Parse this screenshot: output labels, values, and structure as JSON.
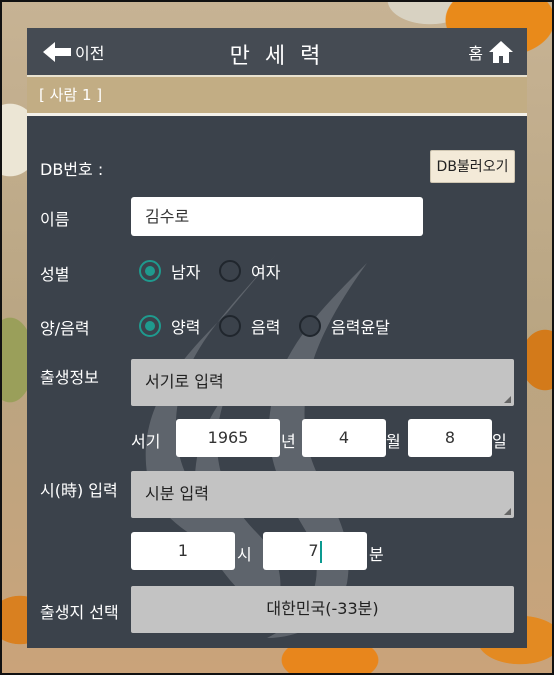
{
  "header": {
    "back_label": "이전",
    "title": "만 세 력",
    "home_label": "홈"
  },
  "section": {
    "title": "[ 사람 1 ]"
  },
  "form": {
    "db": {
      "label": "DB번호 :",
      "button": "DB불러오기"
    },
    "name": {
      "label": "이름",
      "value": "김수로"
    },
    "gender": {
      "label": "성별",
      "options": [
        {
          "label": "남자",
          "selected": true
        },
        {
          "label": "여자",
          "selected": false
        }
      ]
    },
    "calendar": {
      "label": "양/음력",
      "options": [
        {
          "label": "양력",
          "selected": true
        },
        {
          "label": "음력",
          "selected": false
        },
        {
          "label": "음력윤달",
          "selected": false
        }
      ]
    },
    "birth": {
      "label": "출생정보",
      "mode": "서기로 입력",
      "era_label": "서기",
      "year": "1965",
      "year_unit": "년",
      "month": "4",
      "month_unit": "월",
      "day": "8",
      "day_unit": "일"
    },
    "time": {
      "label": "시(時) 입력",
      "mode": "시분 입력",
      "hour": "1",
      "hour_unit": "시",
      "minute": "7",
      "minute_unit": "분"
    },
    "place": {
      "label": "출생지 선택",
      "value": "대한민국(-33분)"
    }
  },
  "colors": {
    "panel": "#3b424b",
    "header": "#454b53",
    "section": "#c2ad84",
    "accent": "#1f9a8e"
  }
}
